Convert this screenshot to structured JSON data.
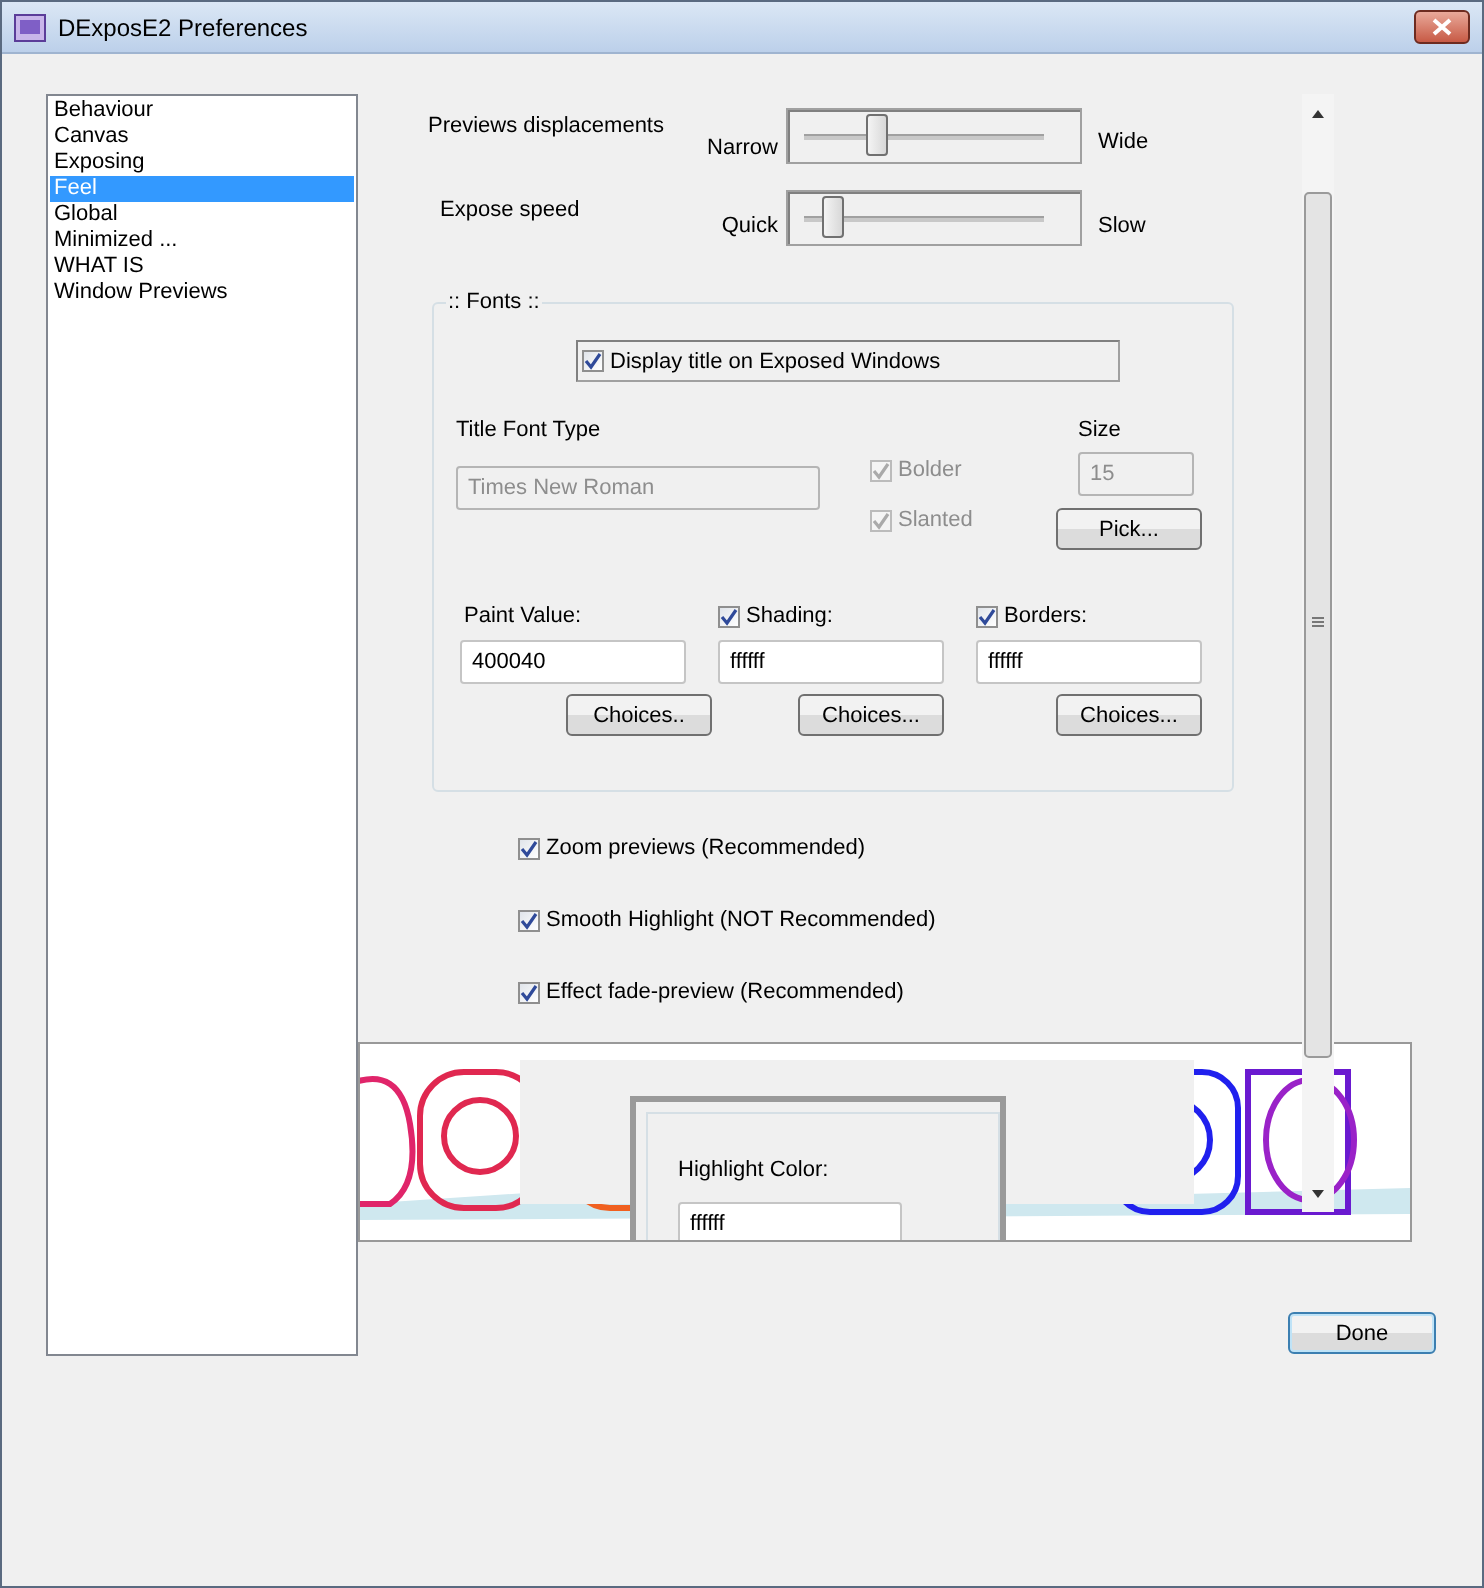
{
  "window": {
    "title": "DExposE2 Preferences"
  },
  "sidebar": {
    "items": [
      {
        "label": "Behaviour",
        "selected": false
      },
      {
        "label": "Canvas",
        "selected": false
      },
      {
        "label": "Exposing",
        "selected": false
      },
      {
        "label": "Feel",
        "selected": true
      },
      {
        "label": "Global",
        "selected": false
      },
      {
        "label": "Minimized ...",
        "selected": false
      },
      {
        "label": "WHAT IS",
        "selected": false
      },
      {
        "label": "Window Previews",
        "selected": false
      }
    ]
  },
  "sliders": [
    {
      "label": "Previews displacements",
      "min_label": "Narrow",
      "max_label": "Wide",
      "level": 0.3
    },
    {
      "label": "Expose speed",
      "min_label": "Quick",
      "max_label": "Slow",
      "level": 0.12
    }
  ],
  "fonts": {
    "legend": ":: Fonts ::",
    "display_title": {
      "label": "Display title on Exposed Windows",
      "checked": true
    },
    "font_type_label": "Title Font Type",
    "font_type": {
      "value": "Times New Roman",
      "disabled": true
    },
    "styles": [
      {
        "label": "Bolder",
        "checked": true,
        "disabled": true
      },
      {
        "label": "Slanted",
        "checked": true,
        "disabled": true
      }
    ],
    "size_label": "Size",
    "size": {
      "value": "15",
      "disabled": true
    },
    "pick_button": "Pick...",
    "colors": [
      {
        "kind": "label",
        "label": "Paint Value:",
        "value": "400040",
        "button": "Choices.."
      },
      {
        "kind": "checkbox",
        "label": "Shading:",
        "checked": true,
        "value": "ffffff",
        "button": "Choices..."
      },
      {
        "kind": "checkbox",
        "label": "Borders:",
        "checked": true,
        "value": "ffffff",
        "button": "Choices..."
      }
    ]
  },
  "options": [
    {
      "label": "Zoom previews (Recommended)",
      "checked": true
    },
    {
      "label": "Smooth Highlight (NOT Recommended)",
      "checked": true
    },
    {
      "label": "Effect fade-preview (Recommended)",
      "checked": true
    }
  ],
  "highlight": {
    "label": "Highlight Color:",
    "value": "ffffff"
  },
  "done_button": "Done"
}
